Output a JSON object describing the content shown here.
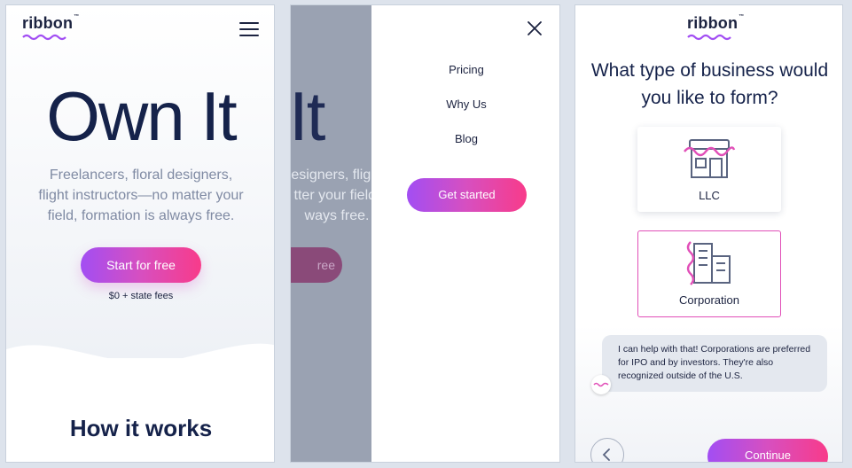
{
  "brand": {
    "logo_text": "ribbon",
    "accent_start": "#a24ef3",
    "accent_end": "#f83b8a",
    "navy": "#15224a"
  },
  "landing": {
    "menu_icon": "hamburger-menu-icon",
    "headline": "Own It",
    "subtitle": "Freelancers, floral designers, flight instructors—no matter your field, formation is always free.",
    "cta_label": "Start for free",
    "price_note": "$0 + state fees",
    "section_title": "How it works"
  },
  "menu": {
    "close_icon": "close-icon",
    "items": [
      {
        "label": "Pricing"
      },
      {
        "label": "Why Us"
      },
      {
        "label": "Blog"
      }
    ],
    "cta_label": "Get started",
    "ghost_headline": "n It",
    "ghost_subtitle": "esigners, flight\ntter your field,\nways free.",
    "ghost_button": "ree"
  },
  "form": {
    "question": "What type of business would you like to form?",
    "options": [
      {
        "label": "LLC",
        "icon": "storefront-icon",
        "selected": false
      },
      {
        "label": "Corporation",
        "icon": "office-building-icon",
        "selected": true
      }
    ],
    "assistant_message": "I can help with that! Corporations are preferred for IPO and by investors. They're also recognized outside of the U.S.",
    "back_icon": "chevron-left-icon",
    "continue_label": "Continue"
  }
}
